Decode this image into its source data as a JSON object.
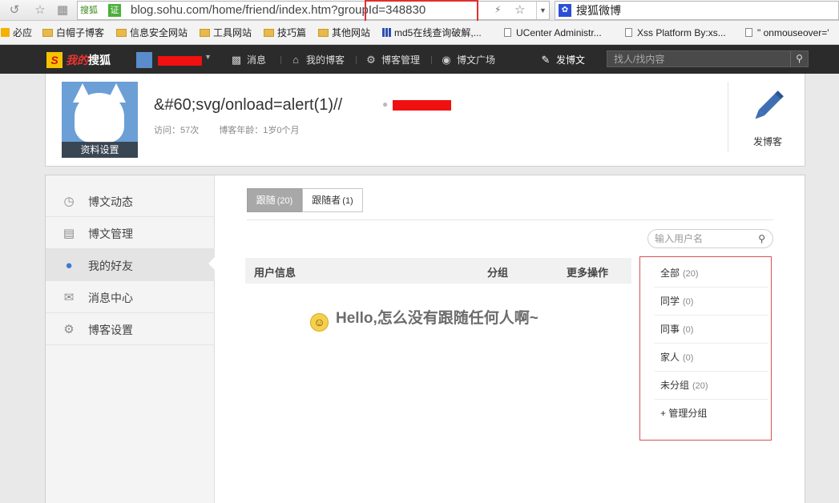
{
  "browser": {
    "site_badge": "搜狐",
    "cert_badge": "证",
    "url": "blog.sohu.com/home/friend/index.htm?groupId=348830",
    "search_engine_label": "搜狐微博",
    "bookmarks": [
      {
        "label": "必应",
        "type": "site"
      },
      {
        "label": "白帽子博客",
        "type": "folder"
      },
      {
        "label": "信息安全网站",
        "type": "folder"
      },
      {
        "label": "工具网站",
        "type": "folder"
      },
      {
        "label": "技巧篇",
        "type": "folder"
      },
      {
        "label": "其他网站",
        "type": "folder"
      },
      {
        "label": "md5在线查询破解,...",
        "type": "grid"
      },
      {
        "label": "UCenter Administr...",
        "type": "page"
      },
      {
        "label": "Xss Platform By:xs...",
        "type": "page"
      },
      {
        "label": "\" onmouseover='",
        "type": "page"
      }
    ]
  },
  "topbar": {
    "logo_my": "我的",
    "logo_brand": "搜狐",
    "nav": [
      "消息",
      "我的博客",
      "博客管理",
      "博文广场"
    ],
    "post_label": "发博文",
    "search_placeholder": "找人/找内容"
  },
  "profile": {
    "avatar_label": "资料设置",
    "title": "&#60;svg/onload=alert(1)//",
    "visits": "访问：57次",
    "age": "博客年龄：1岁0个月",
    "post_button": "发博客"
  },
  "sidebar": {
    "items": [
      {
        "label": "博文动态",
        "icon": "clock-icon"
      },
      {
        "label": "博文管理",
        "icon": "document-icon"
      },
      {
        "label": "我的好友",
        "icon": "person-icon",
        "active": true
      },
      {
        "label": "消息中心",
        "icon": "envelope-icon"
      },
      {
        "label": "博客设置",
        "icon": "gear-icon"
      }
    ]
  },
  "tabs": [
    {
      "label": "跟随",
      "count": "(20)",
      "active": true
    },
    {
      "label": "跟随者",
      "count": "(1)",
      "active": false
    }
  ],
  "user_search_placeholder": "输入用户名",
  "table": {
    "columns": [
      "用户信息",
      "分组",
      "更多操作"
    ]
  },
  "empty_message": "Hello,怎么没有跟随任何人啊~",
  "groups": [
    {
      "label": "全部",
      "count": "(20)"
    },
    {
      "label": "同学",
      "count": "(0)"
    },
    {
      "label": "同事",
      "count": "(0)"
    },
    {
      "label": "家人",
      "count": "(0)"
    },
    {
      "label": "未分组",
      "count": "(20)"
    },
    {
      "label": "+ 管理分组",
      "count": ""
    }
  ],
  "colors": {
    "highlight_border": "#e03030",
    "redaction": "#f01010",
    "topbar_bg": "#2b2b2b",
    "active_accent": "#3d7bd1"
  }
}
